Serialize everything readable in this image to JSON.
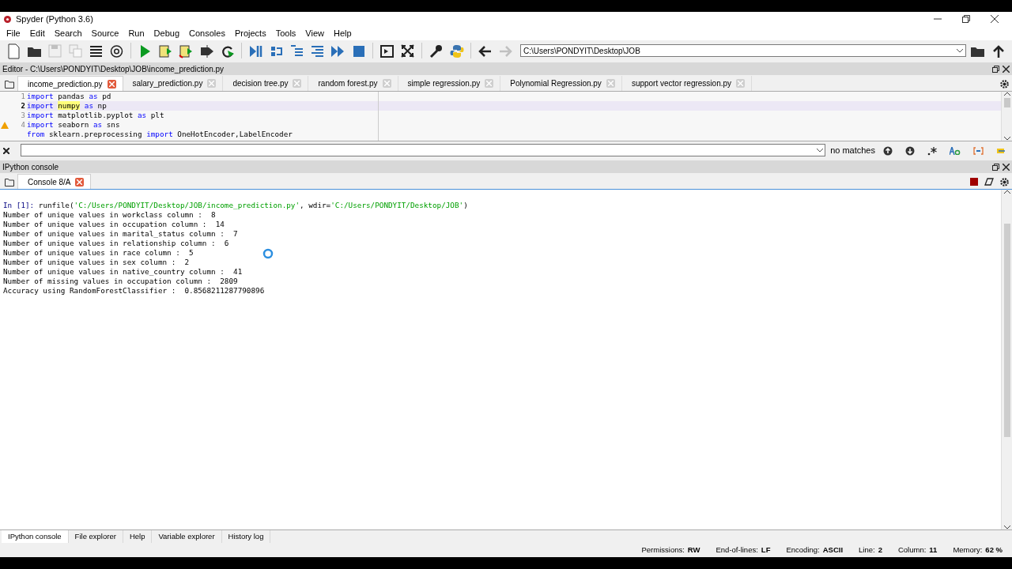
{
  "window": {
    "title": "Spyder (Python 3.6)"
  },
  "menu": [
    "File",
    "Edit",
    "Search",
    "Source",
    "Run",
    "Debug",
    "Consoles",
    "Projects",
    "Tools",
    "View",
    "Help"
  ],
  "toolbar": [
    {
      "kind": "new"
    },
    {
      "kind": "open"
    },
    {
      "kind": "save",
      "disabled": true
    },
    {
      "kind": "saveall",
      "disabled": true
    },
    {
      "kind": "outline"
    },
    {
      "kind": "at"
    },
    {
      "kind": "sep"
    },
    {
      "kind": "run"
    },
    {
      "kind": "runcell"
    },
    {
      "kind": "runcelladv"
    },
    {
      "kind": "runsel"
    },
    {
      "kind": "rerun"
    },
    {
      "kind": "sep"
    },
    {
      "kind": "debug"
    },
    {
      "kind": "step"
    },
    {
      "kind": "stepin"
    },
    {
      "kind": "stepout"
    },
    {
      "kind": "continue"
    },
    {
      "kind": "stop"
    },
    {
      "kind": "sep"
    },
    {
      "kind": "maximize"
    },
    {
      "kind": "fullscreen"
    },
    {
      "kind": "sep"
    },
    {
      "kind": "prefs"
    },
    {
      "kind": "python"
    },
    {
      "kind": "sep"
    },
    {
      "kind": "back"
    },
    {
      "kind": "forward",
      "disabled": true
    }
  ],
  "path": {
    "value": "C:\\Users\\PONDYIT\\Desktop\\JOB"
  },
  "editor": {
    "title": "Editor - C:\\Users\\PONDYIT\\Desktop\\JOB\\income_prediction.py",
    "tabs": [
      {
        "label": "income_prediction.py",
        "selected": true
      },
      {
        "label": "salary_prediction.py",
        "selected": false
      },
      {
        "label": "decision tree.py",
        "selected": false
      },
      {
        "label": "random forest.py",
        "selected": false
      },
      {
        "label": "simple regression.py",
        "selected": false
      },
      {
        "label": "Polynomial Regression.py",
        "selected": false
      },
      {
        "label": "support vector regression.py",
        "selected": false
      }
    ],
    "lines": [
      {
        "number": "1",
        "current": false,
        "warning": false,
        "tokens": [
          {
            "text": "import",
            "kind": "keyword"
          },
          {
            "text": " pandas ",
            "kind": "plain"
          },
          {
            "text": "as",
            "kind": "keyword"
          },
          {
            "text": " pd",
            "kind": "plain"
          }
        ]
      },
      {
        "number": "2",
        "current": true,
        "warning": false,
        "tokens": [
          {
            "text": "import ",
            "kind": "keyword"
          },
          {
            "text": "numpy",
            "kind": "occurrence"
          },
          {
            "text": " as",
            "kind": "keyword"
          },
          {
            "text": " np",
            "kind": "plain"
          }
        ]
      },
      {
        "number": "3",
        "current": false,
        "warning": false,
        "tokens": [
          {
            "text": "import",
            "kind": "keyword"
          },
          {
            "text": " matplotlib.pyplot ",
            "kind": "plain"
          },
          {
            "text": "as",
            "kind": "keyword"
          },
          {
            "text": " plt",
            "kind": "plain"
          }
        ]
      },
      {
        "number": "4",
        "current": false,
        "warning": true,
        "tokens": [
          {
            "text": "import",
            "kind": "keyword"
          },
          {
            "text": " seaborn ",
            "kind": "plain"
          },
          {
            "text": "as",
            "kind": "keyword"
          },
          {
            "text": " sns",
            "kind": "plain"
          }
        ]
      },
      {
        "current": false,
        "warning": false,
        "tokens": [
          {
            "text": "from",
            "kind": "keyword"
          },
          {
            "text": " sklearn.preprocessing ",
            "kind": "plain"
          },
          {
            "text": "import",
            "kind": "keyword"
          },
          {
            "text": " OneHotEncoder,LabelEncoder",
            "kind": "plain"
          }
        ]
      }
    ]
  },
  "find": {
    "status": "no matches"
  },
  "console": {
    "title": "IPython console",
    "tabs": [
      {
        "label": "Console 8/A",
        "selected": true
      }
    ],
    "busy": true,
    "lines": [
      {
        "tokens": [
          {
            "text": "In [1]:",
            "kind": "prompt"
          },
          {
            "text": " runfile(",
            "kind": "plain"
          },
          {
            "text": "'C:/Users/PONDYIT/Desktop/JOB/income_prediction.py'",
            "kind": "string"
          },
          {
            "text": ", wdir=",
            "kind": "plain"
          },
          {
            "text": "'C:/Users/PONDYIT/Desktop/JOB'",
            "kind": "string"
          },
          {
            "text": ")",
            "kind": "plain"
          }
        ]
      },
      {
        "tokens": [
          {
            "text": "Number of unique values in workclass column :  8",
            "kind": "plain"
          }
        ]
      },
      {
        "tokens": [
          {
            "text": "Number of unique values in occupation column :  14",
            "kind": "plain"
          }
        ]
      },
      {
        "tokens": [
          {
            "text": "Number of unique values in marital_status column :  7",
            "kind": "plain"
          }
        ]
      },
      {
        "tokens": [
          {
            "text": "Number of unique values in relationship column :  6",
            "kind": "plain"
          }
        ]
      },
      {
        "tokens": [
          {
            "text": "Number of unique values in race column :  5",
            "kind": "plain"
          }
        ]
      },
      {
        "tokens": [
          {
            "text": "Number of unique values in sex column :  2",
            "kind": "plain"
          }
        ]
      },
      {
        "tokens": [
          {
            "text": "Number of unique values in native_country column :  41",
            "kind": "plain"
          }
        ]
      },
      {
        "tokens": [
          {
            "text": "Number of missing values in occupation column :  2809",
            "kind": "plain"
          }
        ]
      },
      {
        "tokens": [
          {
            "text": "Accuracy using RandomForestClassifier :  0.8568211287790896",
            "kind": "plain"
          }
        ]
      }
    ]
  },
  "pane_tabs": [
    {
      "label": "IPython console",
      "selected": true
    },
    {
      "label": "File explorer",
      "selected": false
    },
    {
      "label": "Help",
      "selected": false
    },
    {
      "label": "Variable explorer",
      "selected": false
    },
    {
      "label": "History log",
      "selected": false
    }
  ],
  "status_bar": [
    {
      "label": "Permissions:",
      "value": "RW"
    },
    {
      "label": "End-of-lines:",
      "value": "LF"
    },
    {
      "label": "Encoding:",
      "value": "ASCII"
    },
    {
      "label": "Line:",
      "value": "2"
    },
    {
      "label": "Column:",
      "value": "11"
    },
    {
      "label": "Memory:",
      "value": "62 %"
    }
  ]
}
